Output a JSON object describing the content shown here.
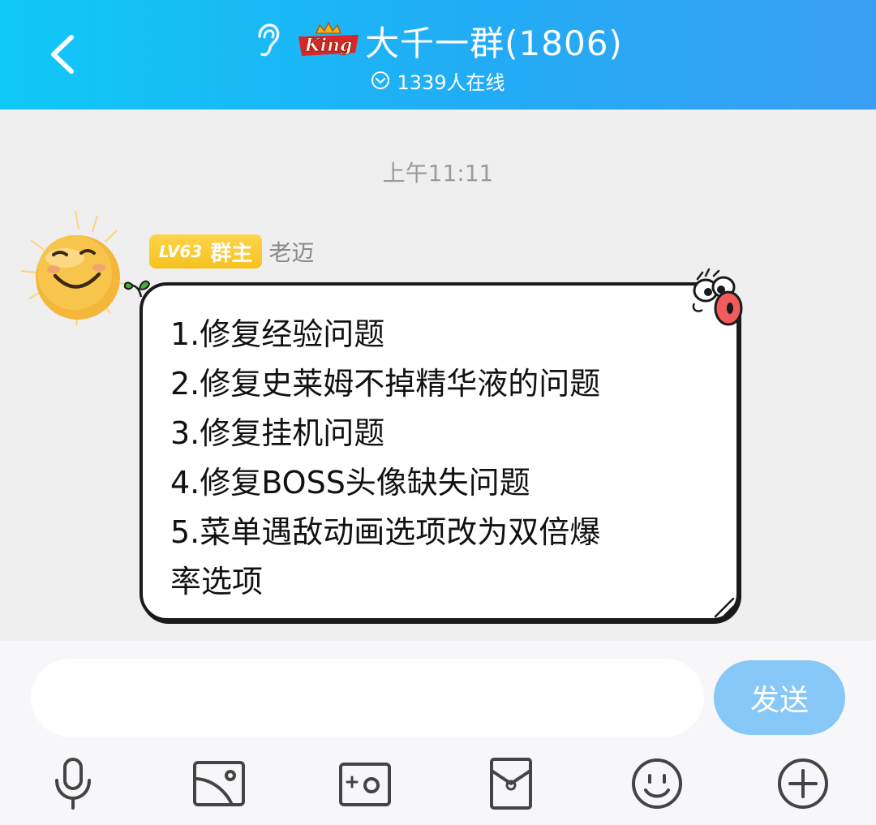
{
  "header": {
    "title": "大千一群(1806)",
    "online_status": "1339人在线",
    "icons": {
      "back": "chevron-left-icon",
      "listen_mode": "ear-icon",
      "logo": "king-logo",
      "online": "chevron-down-circle-icon"
    },
    "colors": {
      "gradient_start": "#0fc8f7",
      "gradient_end": "#3a9ff2"
    }
  },
  "chat": {
    "timestamp": "上午11:11",
    "messages": [
      {
        "sender": {
          "level": "LV63",
          "role": "群主",
          "name": "老迈",
          "avatar": "sun-smiley-avatar"
        },
        "lines": [
          "1.修复经验问题",
          "2.修复史莱姆不掉精华液的问题",
          "3.修复挂机问题",
          "4.修复BOSS头像缺失问题",
          "5.菜单遇敌动画选项改为双倍爆",
          "率选项"
        ]
      }
    ]
  },
  "composer": {
    "input_value": "",
    "send_label": "发送",
    "send_color": "#87c8f8",
    "tools": [
      "microphone-icon",
      "image-icon",
      "camera-icon",
      "red-packet-icon",
      "emoji-icon",
      "plus-icon"
    ]
  }
}
